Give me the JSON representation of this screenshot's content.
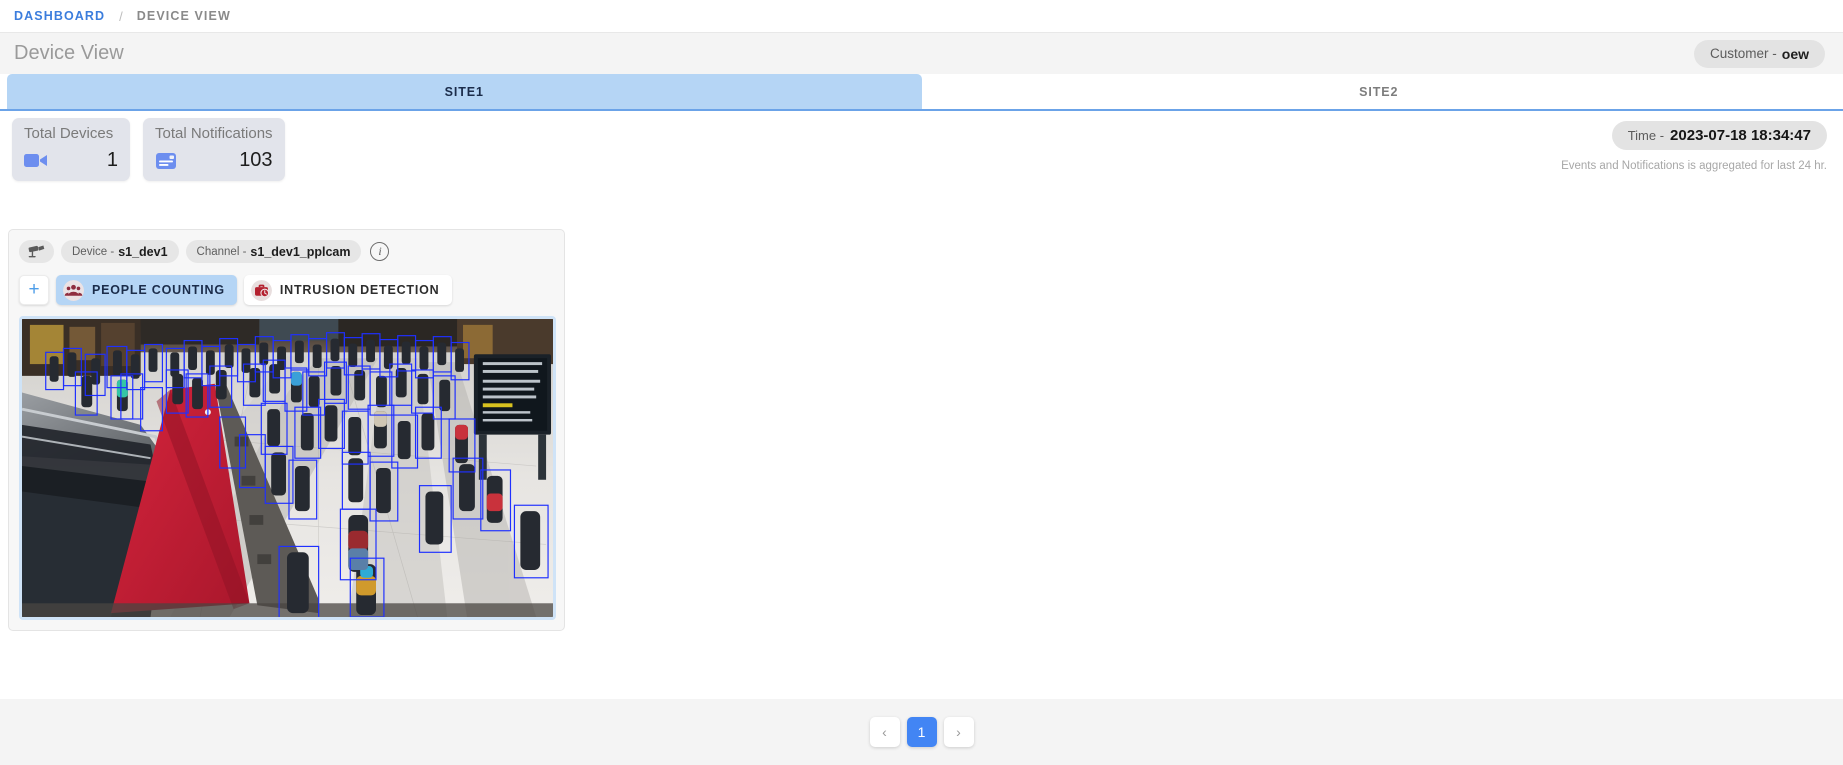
{
  "breadcrumb": {
    "items": [
      {
        "label": "DASHBOARD",
        "state": "link"
      },
      {
        "label": "DEVICE VIEW",
        "state": "current"
      }
    ],
    "separator": "/"
  },
  "header": {
    "title": "Device View",
    "customer": {
      "label": "Customer -",
      "value": "oew"
    }
  },
  "site_tabs": [
    {
      "label": "SITE1",
      "active": true
    },
    {
      "label": "SITE2",
      "active": false
    }
  ],
  "stats": [
    {
      "label": "Total Devices",
      "value": "1",
      "icon": "video-camera-icon",
      "icon_color": "#6d8eef"
    },
    {
      "label": "Total Notifications",
      "value": "103",
      "icon": "notification-note-icon",
      "icon_color": "#6d8eef"
    }
  ],
  "time": {
    "label": "Time -",
    "value": "2023-07-18 18:34:47",
    "note": "Events and Notifications is aggregated for last 24 hr."
  },
  "device_panel": {
    "camera_icon": "cctv-camera-icon",
    "device": {
      "label": "Device -",
      "value": "s1_dev1"
    },
    "channel": {
      "label": "Channel -",
      "value": "s1_dev1_pplcam"
    },
    "info_icon": "info-icon",
    "info_glyph": "i",
    "add_button": {
      "label": "+",
      "icon": "plus-icon"
    },
    "analytics_tabs": [
      {
        "label": "PEOPLE COUNTING",
        "active": true,
        "icon": "people-group-icon",
        "icon_color": "#8f2d3f"
      },
      {
        "label": "INTRUSION DETECTION",
        "active": false,
        "icon": "intrusion-alarm-icon",
        "icon_color": "#b4202f"
      }
    ],
    "video": {
      "name": "people-counting-video-feed",
      "scene": "Train station concourse with people detection bounding boxes",
      "box_color": "#1f30ff"
    }
  },
  "pagination": {
    "prev": "‹",
    "next": "›",
    "pages": [
      {
        "label": "1",
        "current": true
      }
    ]
  },
  "colors": {
    "accent_blue": "#4285f4",
    "active_tab_bg": "#b5d5f5",
    "chip_bg": "#e3e3e3",
    "card_bg": "#e2e4eb",
    "page_bg": "#f4f4f4"
  }
}
